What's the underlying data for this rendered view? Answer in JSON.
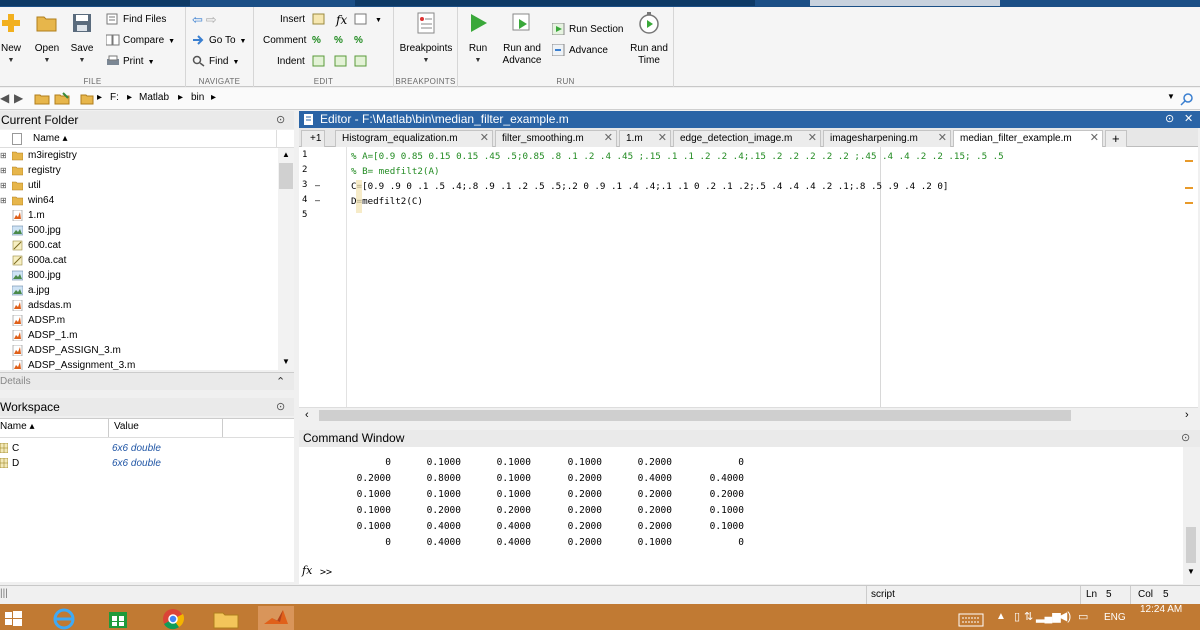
{
  "ribbon": {
    "file": {
      "label": "FILE",
      "new": "New",
      "open": "Open",
      "save": "Save",
      "find_files": "Find Files",
      "compare": "Compare",
      "print": "Print"
    },
    "navigate": {
      "label": "NAVIGATE",
      "go_to": "Go To",
      "find": "Find"
    },
    "edit": {
      "label": "EDIT",
      "insert": "Insert",
      "comment": "Comment",
      "indent": "Indent",
      "fx_glyph": "fx"
    },
    "breakpoints": {
      "label": "BREAKPOINTS",
      "breakpoints": "Breakpoints"
    },
    "run": {
      "label": "RUN",
      "run": "Run",
      "run_and_advance_1": "Run and",
      "run_and_advance_2": "Advance",
      "run_section": "Run Section",
      "advance": "Advance",
      "run_and_time_1": "Run and",
      "run_and_time_2": "Time"
    }
  },
  "address": {
    "drive": "F:",
    "folder1": "Matlab",
    "folder2": "bin"
  },
  "current_folder": {
    "title": "Current Folder",
    "col_name": "Name ▴",
    "files": [
      {
        "name": "m3iregistry",
        "icon": "folder-icon",
        "expandable": true
      },
      {
        "name": "registry",
        "icon": "folder-icon",
        "expandable": true
      },
      {
        "name": "util",
        "icon": "folder-icon",
        "expandable": true
      },
      {
        "name": "win64",
        "icon": "folder-icon",
        "expandable": true
      },
      {
        "name": "1.m",
        "icon": "mfile-icon",
        "expandable": false
      },
      {
        "name": "500.jpg",
        "icon": "image-icon",
        "expandable": false
      },
      {
        "name": "600.cat",
        "icon": "cat-icon",
        "expandable": false
      },
      {
        "name": "600a.cat",
        "icon": "cat-icon",
        "expandable": false
      },
      {
        "name": "800.jpg",
        "icon": "image-icon",
        "expandable": false
      },
      {
        "name": "a.jpg",
        "icon": "image-icon",
        "expandable": false
      },
      {
        "name": "adsdas.m",
        "icon": "mfile-icon",
        "expandable": false
      },
      {
        "name": "ADSP.m",
        "icon": "mfile-icon",
        "expandable": false
      },
      {
        "name": "ADSP_1.m",
        "icon": "mfile-icon",
        "expandable": false
      },
      {
        "name": "ADSP_ASSIGN_3.m",
        "icon": "mfile-icon",
        "expandable": false
      },
      {
        "name": "ADSP_Assignment_3.m",
        "icon": "mfile-icon",
        "expandable": false
      }
    ]
  },
  "details": {
    "title": "Details"
  },
  "workspace": {
    "title": "Workspace",
    "col_name": "Name ▴",
    "col_value": "Value",
    "vars": [
      {
        "name": "C",
        "value": "6x6 double"
      },
      {
        "name": "D",
        "value": "6x6 double"
      }
    ]
  },
  "editor": {
    "title": "Editor - F:\\Matlab\\bin\\median_filter_example.m",
    "tab_add": "+1",
    "tabs": [
      "Histogram_equalization.m",
      "filter_smoothing.m",
      "1.m",
      "edge_detection_image.m",
      "imagesharpening.m",
      "median_filter_example.m"
    ],
    "new_tab": "+",
    "lines": [
      {
        "num": "1",
        "dash": "",
        "text": "% A=[0.9 0.85 0.15 0.15 .45 .5;0.85 .8 .1 .2 .4 .45 ;.15 .1 .1 .2 .2 .4;.15 .2 .2 .2 .2 .2 ;.45 .4 .4 .2 .2 .15; .5 .5",
        "comment": true
      },
      {
        "num": "2",
        "dash": "",
        "text": "% B= medfilt2(A)",
        "comment": true
      },
      {
        "num": "3",
        "dash": "–",
        "text": "C=[0.9 .9 0 .1 .5 .4;.8 .9 .1 .2 .5 .5;.2 0 .9 .1 .4 .4;.1 .1 0 .2 .1 .2;.5 .4 .4 .4 .2 .1;.8 .5 .9 .4 .2 0]",
        "comment": false
      },
      {
        "num": "4",
        "dash": "–",
        "text": "D=medfilt2(C)",
        "comment": false
      },
      {
        "num": "5",
        "dash": "",
        "text": "",
        "comment": false
      }
    ]
  },
  "command_window": {
    "title": "Command Window",
    "rows": [
      [
        "0",
        "0.1000",
        "0.1000",
        "0.1000",
        "0.2000",
        "0"
      ],
      [
        "0.2000",
        "0.8000",
        "0.1000",
        "0.2000",
        "0.4000",
        "0.4000"
      ],
      [
        "0.1000",
        "0.1000",
        "0.1000",
        "0.2000",
        "0.2000",
        "0.2000"
      ],
      [
        "0.1000",
        "0.2000",
        "0.2000",
        "0.2000",
        "0.2000",
        "0.1000"
      ],
      [
        "0.1000",
        "0.4000",
        "0.4000",
        "0.2000",
        "0.2000",
        "0.1000"
      ],
      [
        "0",
        "0.4000",
        "0.4000",
        "0.2000",
        "0.1000",
        "0"
      ]
    ],
    "fx": "fx",
    "prompt": ">>"
  },
  "status": {
    "mode": "script",
    "ln_label": "Ln",
    "ln": "5",
    "col_label": "Col",
    "col": "5"
  },
  "taskbar": {
    "lang": "ENG",
    "time": "12:24 AM"
  },
  "colors": {
    "editor_title": "#2a64a6",
    "comment_green": "#228b22",
    "taskbar": "#c17a33",
    "workspace_value": "#1f55a5"
  }
}
